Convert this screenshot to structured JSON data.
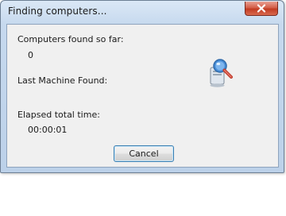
{
  "window": {
    "title": "Finding computers..."
  },
  "content": {
    "computers_found_label": "Computers found so far:",
    "computers_found_value": "0",
    "last_machine_label": "Last Machine Found:",
    "last_machine_value": "",
    "elapsed_label": "Elapsed total time:",
    "elapsed_value": "00:00:01"
  },
  "buttons": {
    "cancel_label": "Cancel"
  },
  "icons": {
    "close": "close-icon",
    "search": "computer-search-icon"
  },
  "colors": {
    "close_button": "#c23b22",
    "focus_border": "#3c7fb1",
    "client_background": "#f0f0f0"
  }
}
